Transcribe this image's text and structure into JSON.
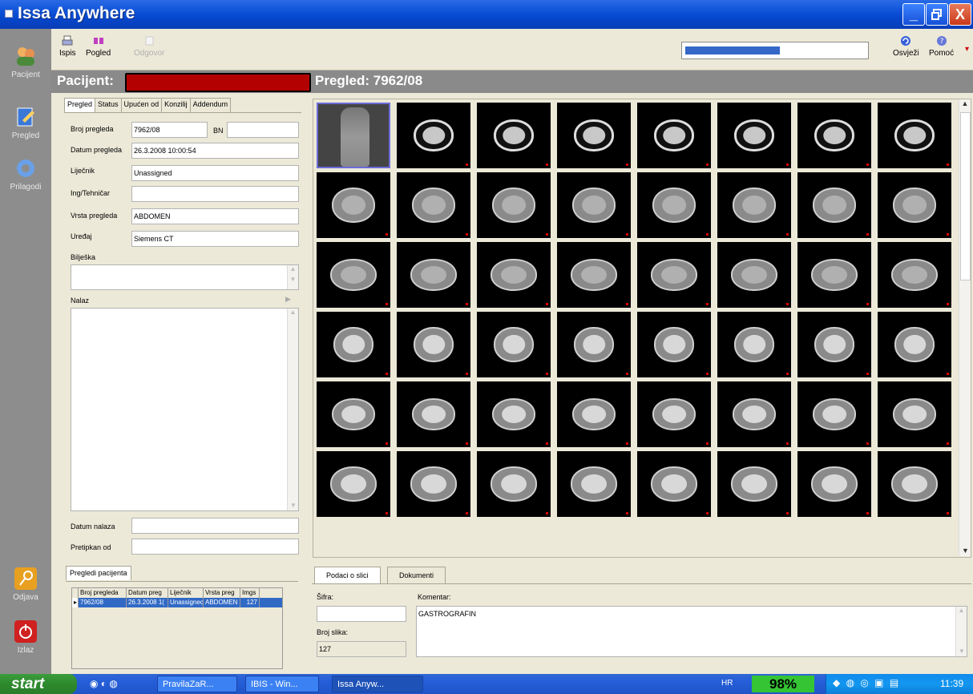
{
  "window": {
    "title": "Issa Anywhere",
    "minimize": "_",
    "maximize": "▫",
    "close": "X"
  },
  "leftnav": {
    "items": [
      {
        "label": "Pacijent",
        "icon": "users-icon"
      },
      {
        "label": "Pregled",
        "icon": "edit-icon"
      },
      {
        "label": "Prilagodi",
        "icon": "gear-icon"
      },
      {
        "label": "Odjava",
        "icon": "key-icon"
      },
      {
        "label": "Izlaz",
        "icon": "power-icon"
      }
    ]
  },
  "toolbar": {
    "ispis": "Ispis",
    "pogled": "Pogled",
    "odgovor": "Odgovor",
    "osvjezi": "Osvježi",
    "pomoc": "Pomoć",
    "progress": 0.52
  },
  "header": {
    "pacijent_label": "Pacijent:",
    "pregled_label": "Pregled: 7962/08"
  },
  "detail_tabs": [
    "Pregled",
    "Status",
    "Upućen od",
    "Konzilij",
    "Addendum"
  ],
  "form": {
    "broj_pregleda_label": "Broj pregleda",
    "broj_pregleda": "7962/08",
    "bn_label": "BN",
    "bn": "",
    "datum_pregleda_label": "Datum pregleda",
    "datum_pregleda": "26.3.2008 10:00:54",
    "lijecnik_label": "Liječnik",
    "lijecnik": "Unassigned",
    "ing_label": "Ing/Tehničar",
    "ing": "",
    "vrsta_label": "Vrsta pregleda",
    "vrsta": "ABDOMEN",
    "uredaj_label": "Uređaj",
    "uredaj": "Siemens CT",
    "biljeska_label": "Bilješka",
    "nalaz_label": "Nalaz",
    "datum_nalaza_label": "Datum nalaza",
    "pretipkan_label": "Pretipkan od"
  },
  "pregledi": {
    "tab": "Pregledi pacijenta",
    "columns": [
      "Broj pregleda",
      "Datum preg",
      "Liječnik",
      "Vrsta preg",
      "Imgs"
    ],
    "rows": [
      [
        "7962/08",
        "26.3.2008 1(",
        "Unassignec",
        "ABDOMEN",
        "127"
      ]
    ]
  },
  "bottom_tabs": [
    "Podaci o slici",
    "Dokumenti"
  ],
  "image_info": {
    "sifra_label": "Šifra:",
    "sifra": "",
    "komentar_label": "Komentar:",
    "komentar": "GASTROGRAFIN",
    "broj_slika_label": "Broj slika:",
    "broj_slika": "127"
  },
  "taskbar": {
    "start": "start",
    "tasks": [
      "PravilaZaR...",
      "IBIS - Win...",
      "Issa Anyw..."
    ],
    "lang": "HR",
    "battery": "98%",
    "clock": "11:39"
  },
  "colors": {
    "accent": "#0a4fd6",
    "header_gray": "#8a8a8a",
    "redaction": "#b30000",
    "selection": "#316ac5"
  }
}
